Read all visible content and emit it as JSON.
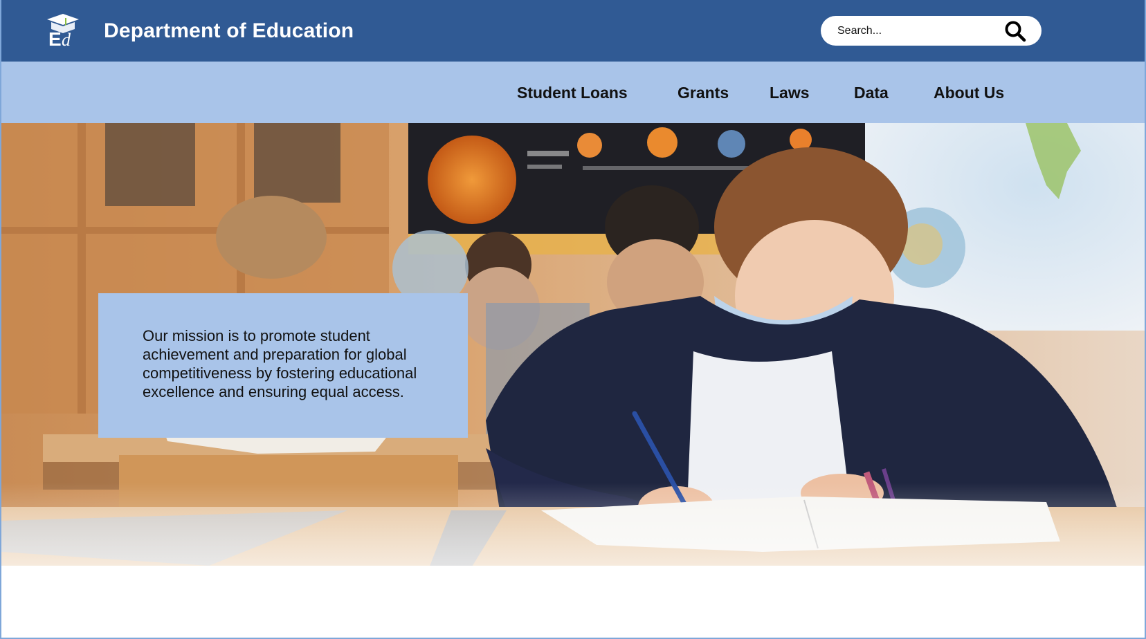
{
  "header": {
    "title": "Department of Education",
    "logo_icon": "ed-graduation-cap-logo-icon",
    "search": {
      "placeholder": "Search...",
      "icon": "search-icon"
    }
  },
  "nav": {
    "items": [
      {
        "label": "Student Loans"
      },
      {
        "label": "Grants"
      },
      {
        "label": "Laws"
      },
      {
        "label": "Data"
      },
      {
        "label": "About Us"
      }
    ]
  },
  "hero": {
    "image": "classroom-student-writing-photo",
    "mission": "Our mission is to promote student achievement and preparation for global competitiveness by fostering educational excellence and ensuring equal access."
  },
  "colors": {
    "header_bg": "#305a94",
    "nav_bg": "#a9c4e9",
    "mission_bg": "#a9c4e9"
  }
}
